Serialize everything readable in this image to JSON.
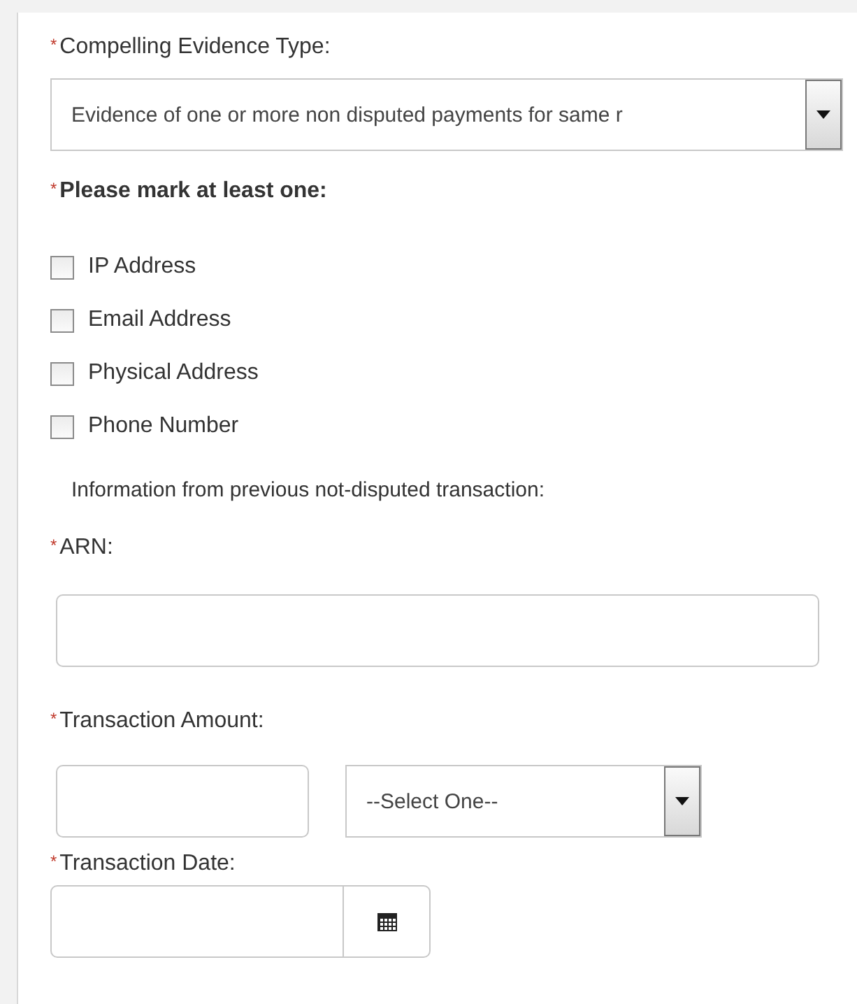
{
  "evidence_type": {
    "required_mark": "*",
    "label": "Compelling Evidence Type:",
    "value": "Evidence of one or more non disputed payments for same r"
  },
  "mark_group": {
    "required_mark": "*",
    "label": "Please mark at least one:",
    "options": [
      {
        "label": "IP Address",
        "checked": false
      },
      {
        "label": "Email Address",
        "checked": false
      },
      {
        "label": "Physical Address",
        "checked": false
      },
      {
        "label": "Phone Number",
        "checked": false
      }
    ]
  },
  "info_text": "Information from previous not-disputed transaction:",
  "arn": {
    "required_mark": "*",
    "label": "ARN:"
  },
  "transaction_amount": {
    "required_mark": "*",
    "label": "Transaction Amount:",
    "currency_value": "--Select One--"
  },
  "transaction_date": {
    "required_mark": "*",
    "label": "Transaction Date:"
  }
}
